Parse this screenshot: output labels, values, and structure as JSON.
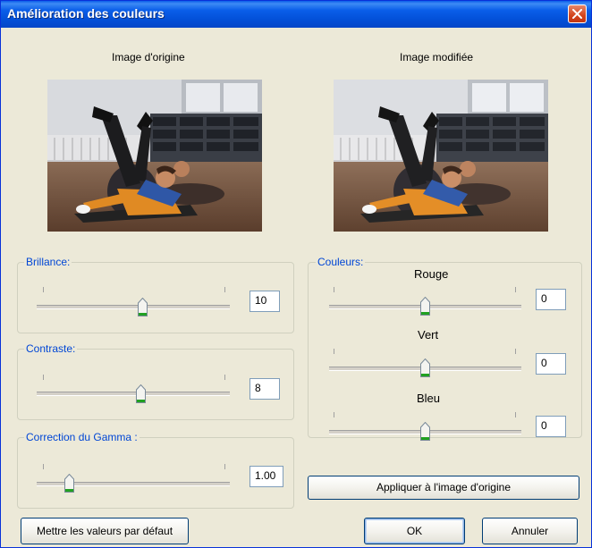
{
  "window": {
    "title": "Amélioration des couleurs"
  },
  "previews": {
    "original_label": "Image d'origine",
    "modified_label": "Image modifiée"
  },
  "brightness": {
    "label": "Brillance:",
    "value": "10",
    "level": 0.55
  },
  "contrast": {
    "label": "Contraste:",
    "value": "8",
    "level": 0.54
  },
  "gamma": {
    "label": "Correction du Gamma :",
    "value": "1.00",
    "level": 0.17
  },
  "colors": {
    "group_label": "Couleurs:",
    "red": {
      "label": "Rouge",
      "value": "0",
      "level": 0.5
    },
    "green": {
      "label": "Vert",
      "value": "0",
      "level": 0.5
    },
    "blue": {
      "label": "Bleu",
      "value": "0",
      "level": 0.5
    }
  },
  "buttons": {
    "apply": "Appliquer à l'image d'origine",
    "defaults": "Mettre les valeurs par défaut",
    "ok": "OK",
    "cancel": "Annuler"
  },
  "theme": {
    "title_bar": "#0a5ee9",
    "group_label_color": "#0046d5",
    "dialog_bg": "#ece9d8",
    "thumb_accent": "#21a121"
  }
}
